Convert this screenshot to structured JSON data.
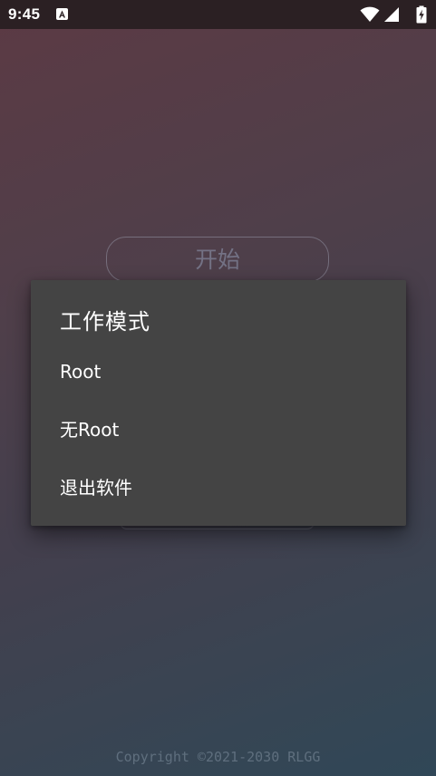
{
  "status_bar": {
    "time": "9:45",
    "icons": [
      "notification-a-icon",
      "wifi-icon",
      "signal-icon",
      "battery-charging-icon"
    ]
  },
  "main": {
    "start_button_label": "开始"
  },
  "dialog": {
    "title": "工作模式",
    "items": [
      {
        "label": "Root"
      },
      {
        "label": "无Root"
      },
      {
        "label": "退出软件"
      }
    ]
  },
  "footer": {
    "copyright": "Copyright ©2021-2030 RLGG"
  },
  "colors": {
    "dialog_background": "#444444",
    "status_bar_background": "#2b2023",
    "text_primary": "#ffffff"
  }
}
